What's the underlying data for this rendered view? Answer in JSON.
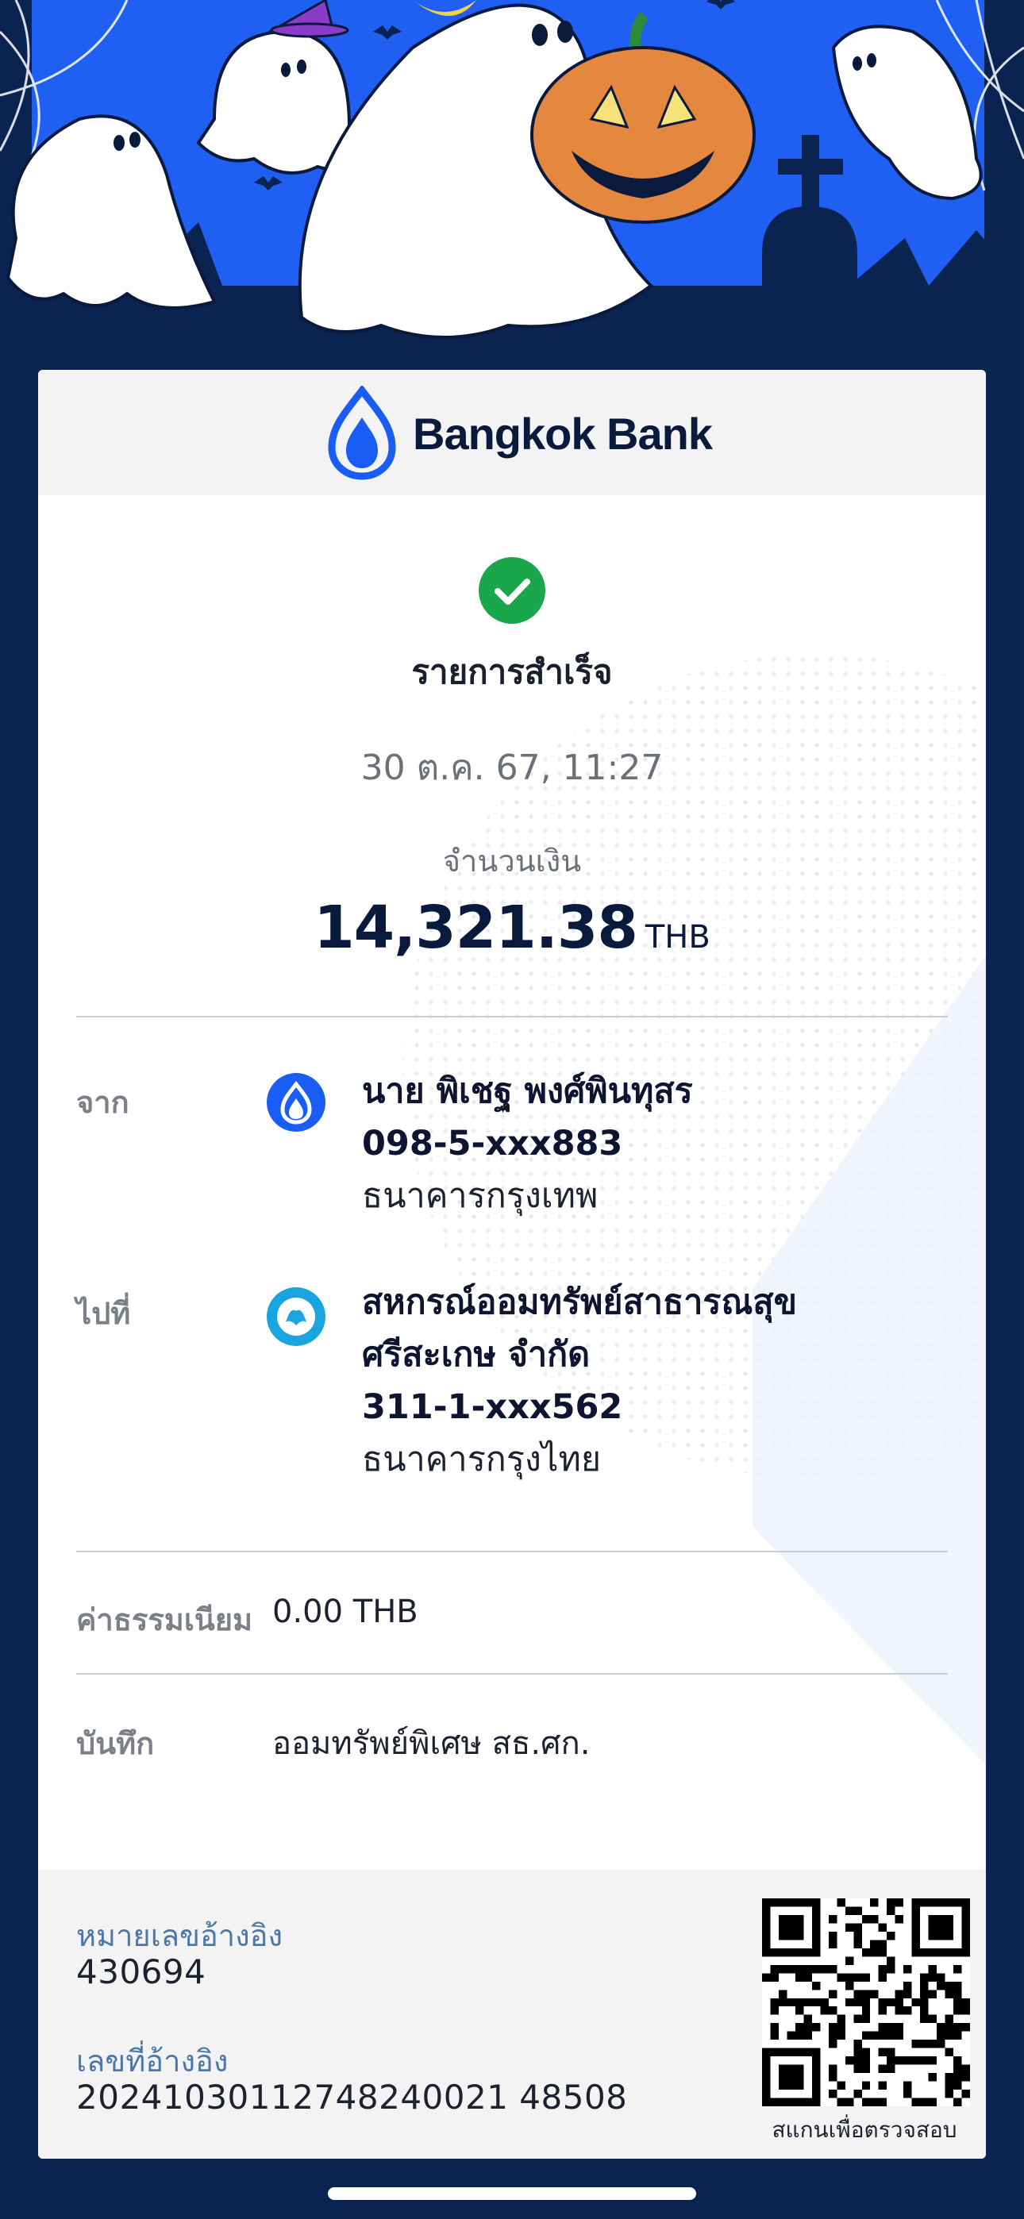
{
  "brand": {
    "name": "Bangkok Bank",
    "color": "#1a5df5"
  },
  "status": {
    "text": "รายการสำเร็จ",
    "icon": "check-circle-icon",
    "color": "#1aa64b"
  },
  "datetime": "30 ต.ค. 67, 11:27",
  "amount": {
    "label": "จำนวนเงิน",
    "value": "14,321.38",
    "currency": "THB"
  },
  "from": {
    "label": "จาก",
    "icon": "bangkok-bank-icon",
    "name": "นาย พิเชฐ พงศ์พินทุสร",
    "account": "098-5-xxx883",
    "bank": "ธนาคารกรุงเทพ"
  },
  "to": {
    "label": "ไปที่",
    "icon": "krungthai-bank-icon",
    "name_line1": "สหกรณ์ออมทรัพย์สาธารณสุข",
    "name_line2": "ศรีสะเกษ จำกัด",
    "account": "311-1-xxx562",
    "bank": "ธนาคารกรุงไทย"
  },
  "fee": {
    "label": "ค่าธรรมเนียม",
    "value": "0.00 THB"
  },
  "memo": {
    "label": "บันทึก",
    "value": "ออมทรัพย์พิเศษ สธ.ศก."
  },
  "reference": {
    "ref_no_label": "หมายเลขอ้างอิง",
    "ref_no_value": "430694",
    "ref_id_label": "เลขที่อ้างอิง",
    "ref_id_value": "20241030112748240021 48508"
  },
  "qr": {
    "caption": "สแกนเพื่อตรวจสอบ",
    "icon": "qr-code-icon"
  }
}
